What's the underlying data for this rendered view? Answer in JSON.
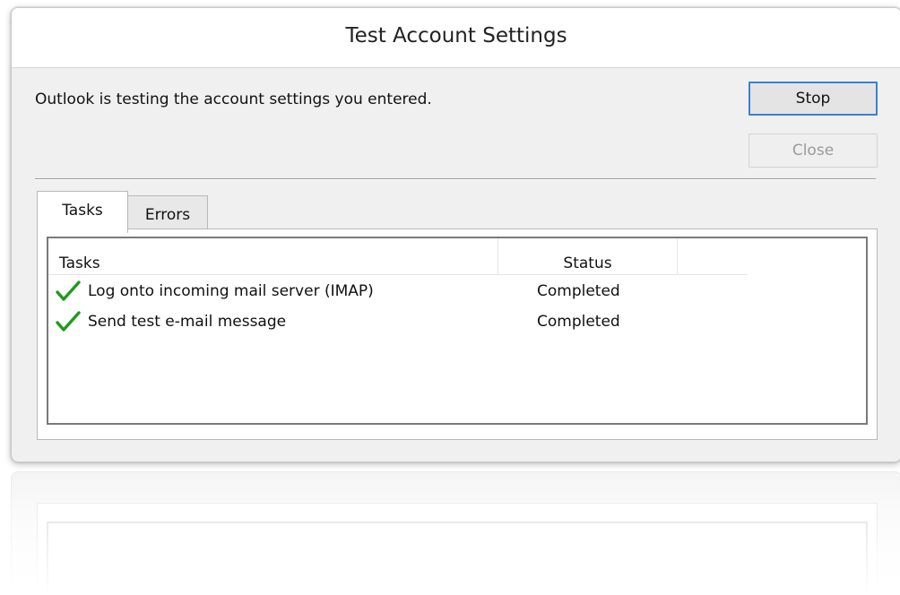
{
  "dialog": {
    "title": "Test Account Settings",
    "message": "Outlook is testing the account settings you entered.",
    "buttons": {
      "stop_label": "Stop",
      "close_label": "Close",
      "close_enabled": false
    }
  },
  "tabs": [
    {
      "label": "Tasks",
      "selected": true
    },
    {
      "label": "Errors",
      "selected": false
    }
  ],
  "task_list": {
    "columns": [
      "Tasks",
      "Status"
    ],
    "rows": [
      {
        "icon": "green-checkmark-icon",
        "task": "Log onto incoming mail server (IMAP)",
        "status": "Completed"
      },
      {
        "icon": "green-checkmark-icon",
        "task": "Send test e-mail message",
        "status": "Completed"
      }
    ]
  },
  "colors": {
    "check_green": "#1e9a1e",
    "default_button_border": "#3c7fd7"
  }
}
